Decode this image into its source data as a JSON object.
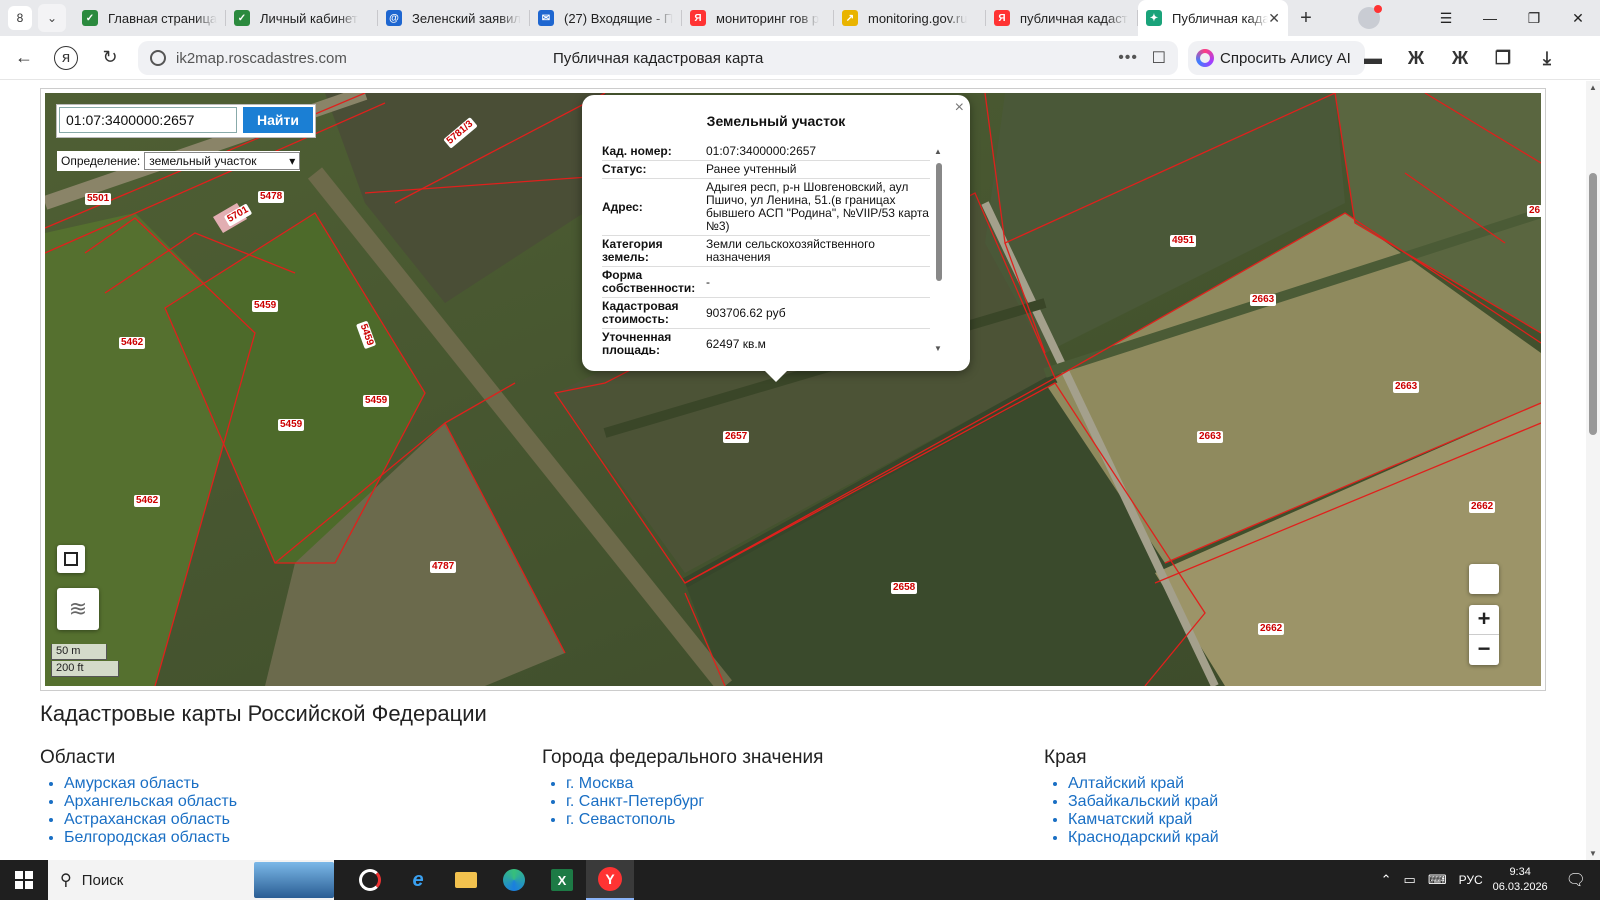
{
  "browser": {
    "tab_count": "8",
    "tabs": [
      {
        "title": "Главная страница",
        "favicon_color": "#2b8a3e",
        "glyph": "✓"
      },
      {
        "title": "Личный кабинет",
        "favicon_color": "#2b8a3e",
        "glyph": "✓"
      },
      {
        "title": "Зеленский заявил",
        "favicon_color": "#1e66d0",
        "glyph": "@"
      },
      {
        "title": "(27) Входящие - П",
        "favicon_color": "#1e66d0",
        "glyph": "✉"
      },
      {
        "title": "мониторинг гов р",
        "favicon_color": "#f33",
        "glyph": "Я"
      },
      {
        "title": "monitoring.gov.ru",
        "favicon_color": "#e9b400",
        "glyph": "↗"
      },
      {
        "title": "публичная кадаст",
        "favicon_color": "#f33",
        "glyph": "Я"
      },
      {
        "title": "Публичная кадастр",
        "favicon_color": "#1aa37a",
        "glyph": "✦",
        "active": true
      }
    ],
    "address": {
      "url": "ik2map.roscadastres.com",
      "page_title": "Публичная кадастровая карта"
    },
    "alice_label": "Спросить Алису AI"
  },
  "map": {
    "search": {
      "value": "01:07:3400000:2657",
      "button": "Найти"
    },
    "definition": {
      "label": "Определение:",
      "selected": "земельный участок"
    },
    "scale": {
      "metric": "50 m",
      "imperial": "200 ft"
    },
    "zoom_in": "+",
    "zoom_out": "−",
    "parcel_labels": [
      "5501",
      "5478",
      "5701",
      "5781/3",
      "5459",
      "5459",
      "5462",
      "5459",
      "5459",
      "5462",
      "4787",
      "2657",
      "2658",
      "4951",
      "2663",
      "2663",
      "2663",
      "2662",
      "2662",
      "26"
    ],
    "popup": {
      "title": "Земельный участок",
      "close": "×",
      "rows": [
        {
          "key": "Кад. номер:",
          "value": "01:07:3400000:2657"
        },
        {
          "key": "Статус:",
          "value": "Ранее учтенный"
        },
        {
          "key": "Адрес:",
          "value": "Адыгея респ, р-н Шовгеновский, аул Пшичо, ул Ленина, 51.(в границах бывшего АСП \"Родина\", №VIIP/53 карта №3)"
        },
        {
          "key": "Категория земель:",
          "value": "Земли сельскохозяйственного назначения"
        },
        {
          "key": "Форма собственности:",
          "value": "-"
        },
        {
          "key": "Кадастровая стоимость:",
          "value": "903706.62 руб"
        },
        {
          "key": "Уточненная площадь:",
          "value": "62497 кв.м"
        }
      ]
    }
  },
  "content": {
    "heading": "Кадастровые карты Российской Федерации",
    "columns": [
      {
        "title": "Области",
        "items": [
          "Амурская область",
          "Архангельская область",
          "Астраханская область",
          "Белгородская область"
        ]
      },
      {
        "title": "Города федерального значения",
        "items": [
          "г. Москва",
          "г. Санкт-Петербург",
          "г. Севастополь"
        ]
      },
      {
        "title": "Края",
        "items": [
          "Алтайский край",
          "Забайкальский край",
          "Камчатский край",
          "Краснодарский край"
        ]
      }
    ]
  },
  "taskbar": {
    "search_label": "Поиск",
    "lang": "РУС",
    "time": "9:34",
    "date": "06.03.2026"
  }
}
